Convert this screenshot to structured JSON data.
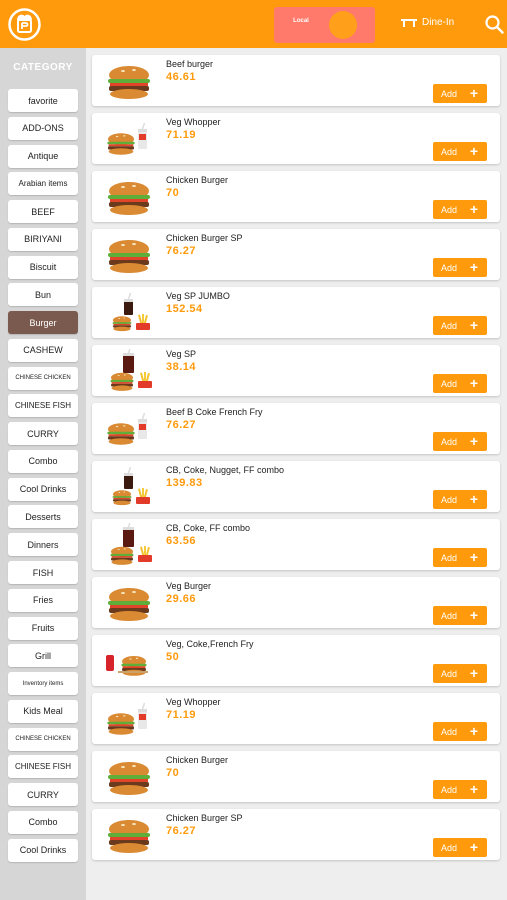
{
  "header": {
    "pill_label": "Local",
    "dinein_label": "Dine-In"
  },
  "sidebar": {
    "title": "CATEGORY",
    "items": [
      {
        "label": "favorite",
        "size": "normal"
      },
      {
        "label": "ADD-ONS",
        "size": "normal"
      },
      {
        "label": "Antique",
        "size": "normal"
      },
      {
        "label": "Arabian items",
        "size": "small"
      },
      {
        "label": "BEEF",
        "size": "normal"
      },
      {
        "label": "BIRIYANI",
        "size": "normal"
      },
      {
        "label": "Biscuit",
        "size": "normal"
      },
      {
        "label": "Bun",
        "size": "normal"
      },
      {
        "label": "Burger",
        "size": "normal",
        "active": true
      },
      {
        "label": "CASHEW",
        "size": "normal"
      },
      {
        "label": "CHINESE CHICKEN",
        "size": "tiny"
      },
      {
        "label": "CHINESE FISH",
        "size": "small"
      },
      {
        "label": "CURRY",
        "size": "normal"
      },
      {
        "label": "Combo",
        "size": "normal"
      },
      {
        "label": "Cool Drinks",
        "size": "normal"
      },
      {
        "label": "Desserts",
        "size": "normal"
      },
      {
        "label": "Dinners",
        "size": "normal"
      },
      {
        "label": "FISH",
        "size": "normal"
      },
      {
        "label": "Fries",
        "size": "normal"
      },
      {
        "label": "Fruits",
        "size": "normal"
      },
      {
        "label": "Grill",
        "size": "normal"
      },
      {
        "label": "Inventory items",
        "size": "tiny"
      },
      {
        "label": "Kids Meal",
        "size": "normal"
      },
      {
        "label": "CHINESE CHICKEN",
        "size": "tiny"
      },
      {
        "label": "CHINESE FISH",
        "size": "small"
      },
      {
        "label": "CURRY",
        "size": "normal"
      },
      {
        "label": "Combo",
        "size": "normal"
      },
      {
        "label": "Cool Drinks",
        "size": "normal"
      }
    ]
  },
  "products": {
    "add_label": "Add",
    "items": [
      {
        "name": "Beef burger",
        "price": "46.61",
        "image": "burger-image"
      },
      {
        "name": "Veg Whopper",
        "price": "71.19",
        "image": "combo-drink-image"
      },
      {
        "name": "Chicken Burger",
        "price": "70",
        "image": "burger-image"
      },
      {
        "name": "Chicken Burger SP",
        "price": "76.27",
        "image": "burger-image"
      },
      {
        "name": "Veg SP JUMBO",
        "price": "152.54",
        "image": "combo-meal-image"
      },
      {
        "name": "Veg SP",
        "price": "38.14",
        "image": "burger-cola-fries-image"
      },
      {
        "name": "Beef B Coke French Fry",
        "price": "76.27",
        "image": "combo-drink-image"
      },
      {
        "name": "CB, Coke, Nugget, FF combo",
        "price": "139.83",
        "image": "combo-meal-image"
      },
      {
        "name": "CB, Coke, FF combo",
        "price": "63.56",
        "image": "burger-cola-fries-image"
      },
      {
        "name": "Veg Burger",
        "price": "29.66",
        "image": "burger-image"
      },
      {
        "name": "Veg, Coke,French Fry",
        "price": "50",
        "image": "burger-can-image"
      },
      {
        "name": "Veg Whopper",
        "price": "71.19",
        "image": "combo-drink-image"
      },
      {
        "name": "Chicken Burger",
        "price": "70",
        "image": "burger-image"
      },
      {
        "name": "Chicken Burger SP",
        "price": "76.27",
        "image": "burger-image"
      }
    ]
  },
  "colors": {
    "accent": "#ff9a0c",
    "active_category": "#7a5a4e",
    "sidebar_bg": "#d6d6d6",
    "pill_bg": "#ff7a6a"
  }
}
